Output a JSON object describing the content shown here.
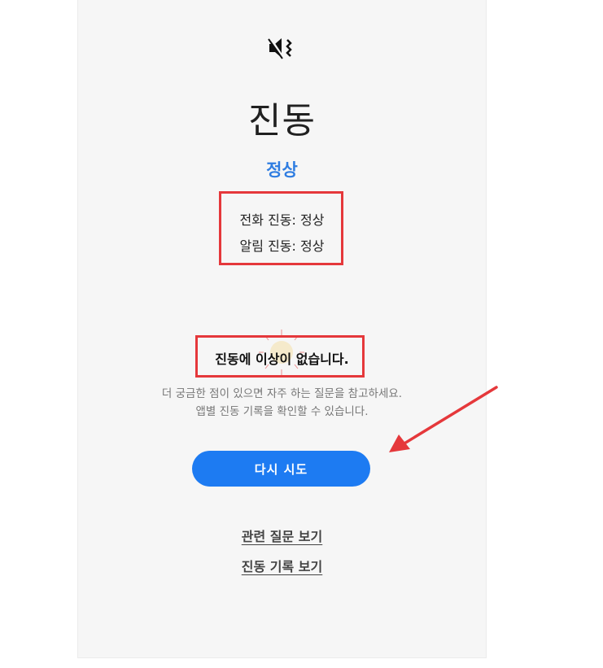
{
  "header": {
    "icon": "vibrate-mute-icon",
    "title": "진동",
    "status": "정상"
  },
  "details": {
    "call_vibration": "전화 진동: 정상",
    "notification_vibration": "알림 진동: 정상"
  },
  "result": {
    "message": "진동에 이상이 없습니다.",
    "description_line1": "더 궁금한 점이 있으면 자주 하는 질문을 참고하세요.",
    "description_line2": "앱별 진동 기록을 확인할 수 있습니다."
  },
  "actions": {
    "retry_label": "다시 시도",
    "related_questions_label": "관련 질문 보기",
    "vibration_history_label": "진동 기록 보기"
  },
  "colors": {
    "accent": "#1d7bf2",
    "status": "#2f7de1",
    "highlight": "#e5383b",
    "background": "#f6f6f6"
  }
}
